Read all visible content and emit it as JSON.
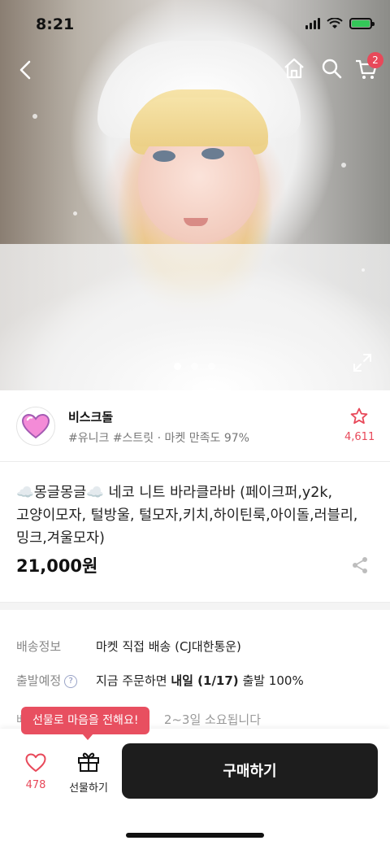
{
  "status_bar": {
    "time": "8:21"
  },
  "nav": {
    "back_icon": "chevron-left-icon",
    "home_icon": "home-icon",
    "search_icon": "search-icon",
    "cart_icon": "cart-icon",
    "cart_badge": "2"
  },
  "gallery": {
    "page_count": 3,
    "active_index": 0
  },
  "seller": {
    "name": "비스크돌",
    "meta": "#유니크 #스트릿 · 마켓 만족도 97%",
    "favorite_count": "4,611"
  },
  "product": {
    "title": "☁️몽글몽글☁️ 네코 니트 바라클라바 (페이크퍼,y2k,고양이모자, 털방울, 털모자,키치,하이틴룩,아이돌,러블리,밍크,겨울모자)",
    "price": "21,000원"
  },
  "shipping": {
    "delivery_label": "배송정보",
    "delivery_value": "마켓 직접 배송 (CJ대한통운)",
    "departure_label": "출발예정",
    "departure_prefix": "지금 주문하면 ",
    "departure_bold": "내일 (1/17)",
    "departure_suffix": " 출발 100%",
    "row3_prefix": "배",
    "row3_text": "2~3일 소요됩니다"
  },
  "tooltip": {
    "text": "선물로 마음을 전해요!"
  },
  "bottom_bar": {
    "like_count": "478",
    "gift_label": "선물하기",
    "buy_label": "구매하기"
  },
  "colors": {
    "accent": "#e8495a",
    "buy_button": "#1d1d1d"
  }
}
